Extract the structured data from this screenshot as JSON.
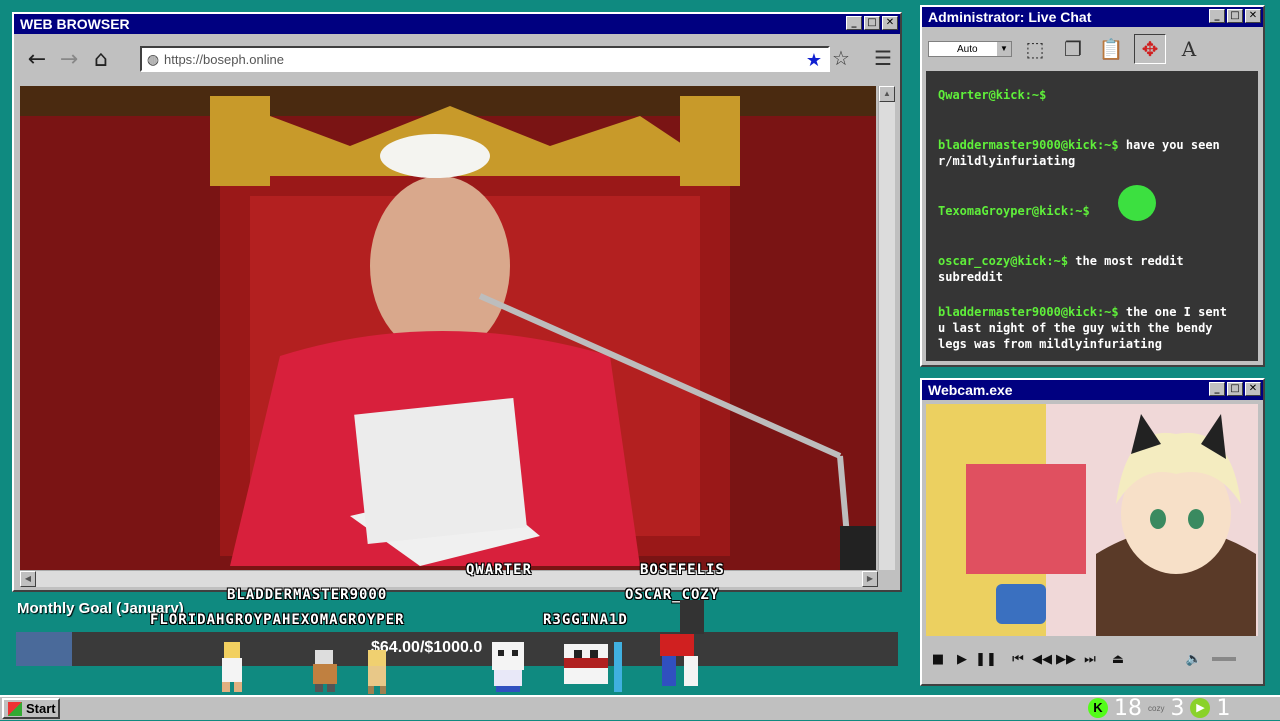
{
  "browser": {
    "title": "WEB BROWSER",
    "url": "https://boseph.online"
  },
  "chat": {
    "title": "Administrator: Live Chat",
    "mode_select": "Auto",
    "messages": [
      {
        "user": "Qwarter@kick:~$",
        "text": ""
      },
      {
        "user": "bladdermaster9000@kick:~$",
        "text": "have you seen r/mildlyinfuriating"
      },
      {
        "user": "TexomaGroyper@kick:~$",
        "text": ""
      },
      {
        "user": "oscar_cozy@kick:~$",
        "text": "the most reddit subreddit"
      },
      {
        "user": "bladdermaster9000@kick:~$",
        "text": "the one I sent u last night of the guy with the bendy legs was from mildlyinfuriating"
      }
    ]
  },
  "webcam": {
    "title": "Webcam.exe"
  },
  "goal": {
    "label": "Monthly Goal (January)",
    "text": "$64.00/$1000.0",
    "fraction": 0.064
  },
  "overlay_names": [
    "BLADDERMASTER9000",
    "FLORIDAHGROYPAHEXOMAGROYPER",
    "QWARTER",
    "BOSEFELIS",
    "OSCAR_COZY",
    "R3GGINA1D"
  ],
  "taskbar": {
    "start_label": "Start",
    "kick_count": "18",
    "cozy_label": "cozy",
    "cozy_count": "3",
    "play_count": "1"
  },
  "colors": {
    "desktop": "#0f8a80",
    "titlebar": "#000080",
    "chat_username": "#5fef3a",
    "chat_bg": "#353535",
    "kick_green": "#53fc18"
  }
}
